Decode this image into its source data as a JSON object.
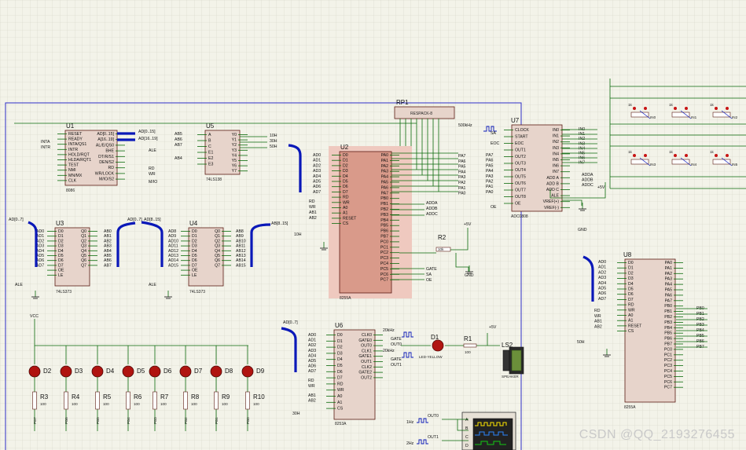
{
  "chips": {
    "u1": {
      "ref": "U1",
      "type": "8086",
      "left_pins": [
        "RESET",
        "READY",
        "INTA/QS1",
        "INTR",
        "HOLD/RQT",
        "HLDA/RQT1",
        "TEST",
        "NMI",
        "MN/MX",
        "CLK"
      ],
      "right_pins": [
        "AD[0..15]",
        "A[16..19]",
        "AL/E/QS0",
        "BHE",
        "DT/R/S1",
        "DEN/S2",
        "RD",
        "WR/LOCK",
        "M/IO/S2"
      ],
      "in_labels": [
        "INTA",
        "INTR"
      ],
      "out_labels": [
        "AD[0..15]",
        "AD[16..19]",
        "ALE",
        "RD",
        "WR",
        "M/IO"
      ]
    },
    "u5": {
      "ref": "U5",
      "type": "74LS138",
      "left_pins": [
        "A",
        "B",
        "C",
        "E1",
        "E2",
        "E3"
      ],
      "right_pins": [
        "Y0",
        "Y1",
        "Y2",
        "Y3",
        "Y4",
        "Y5",
        "Y6",
        "Y7"
      ],
      "in_labels": [
        "AB5",
        "AB6",
        "AB7",
        "AB4"
      ],
      "out_labels": [
        "10H",
        "30H",
        "50H"
      ]
    },
    "u2": {
      "ref": "U2",
      "type": "8255A",
      "left_pins": [
        "D0",
        "D1",
        "D2",
        "D3",
        "D4",
        "D5",
        "D6",
        "D7",
        "RD",
        "WR",
        "A0",
        "A1",
        "RESET",
        "CS"
      ],
      "right_pins": [
        "PA0",
        "PA1",
        "PA2",
        "PA3",
        "PA4",
        "PA5",
        "PA6",
        "PA7",
        "PB0",
        "PB1",
        "PB2",
        "PB3",
        "PB4",
        "PB5",
        "PB6",
        "PB7",
        "PC0",
        "PC1",
        "PC2",
        "PC3",
        "PC4",
        "PC5",
        "PC6",
        "PC7"
      ],
      "in_labels": [
        "AD0",
        "AD1",
        "AD2",
        "AD3",
        "AD4",
        "AD5",
        "AD6",
        "AD7",
        "RD",
        "WR",
        "AB1",
        "AB2",
        "10H"
      ],
      "out_labels": [
        "PA7",
        "PA6",
        "PA5",
        "PA4",
        "PA3",
        "PA2",
        "PA1",
        "PA0",
        "ADDA",
        "ADDB",
        "ADDC",
        "GATE",
        "SA",
        "OE"
      ]
    },
    "u7": {
      "ref": "U7",
      "type": "ADC0808",
      "left_pins": [
        "CLOCK",
        "START",
        "EOC",
        "OUT1",
        "OUT2",
        "OUT3",
        "OUT4",
        "OUT5",
        "OUT6",
        "OUT7",
        "OUT8",
        "OE"
      ],
      "right_pins": [
        "IN0",
        "IN1",
        "IN2",
        "IN3",
        "IN4",
        "IN5",
        "IN6",
        "IN7",
        "ADD A",
        "ADD B",
        "ADD C",
        "ALE",
        "VREF(+)",
        "VREF(-)"
      ],
      "in_labels": [
        "SA",
        "EOC",
        "PA7",
        "PA6",
        "PA5",
        "PA4",
        "PA3",
        "PA2",
        "PA1",
        "PA0",
        "OE"
      ],
      "out_labels": [
        "IN0",
        "IN1",
        "IN2",
        "IN3",
        "IN4",
        "IN5",
        "IN6",
        "IN7",
        "ADDA",
        "ADDB",
        "ADDC",
        "+5V",
        "GND"
      ]
    },
    "u3": {
      "ref": "U3",
      "type": "74LS373",
      "left_pins": [
        "D0",
        "D1",
        "D2",
        "D3",
        "D4",
        "D5",
        "D6",
        "D7",
        "OE",
        "LE"
      ],
      "right_pins": [
        "Q0",
        "Q1",
        "Q2",
        "Q3",
        "Q4",
        "Q5",
        "Q6",
        "Q7"
      ],
      "in_labels": [
        "AD0",
        "AD1",
        "AD2",
        "AD3",
        "AD4",
        "AD5",
        "AD6",
        "AD7",
        "ALE"
      ],
      "out_labels": [
        "AB0",
        "AB1",
        "AB2",
        "AB3",
        "AB4",
        "AB5",
        "AB6",
        "AB7"
      ]
    },
    "u4": {
      "ref": "U4",
      "type": "74LS373",
      "left_pins": [
        "D0",
        "D1",
        "D2",
        "D3",
        "D4",
        "D5",
        "D6",
        "D7",
        "OE",
        "LE"
      ],
      "right_pins": [
        "Q0",
        "Q1",
        "Q2",
        "Q3",
        "Q4",
        "Q5",
        "Q6",
        "Q7"
      ],
      "in_labels": [
        "AD8",
        "AD9",
        "AD10",
        "AD11",
        "AD12",
        "AD13",
        "AD14",
        "AD15",
        "ALE"
      ],
      "out_labels": [
        "AB8",
        "AB9",
        "AB10",
        "AB11",
        "AB12",
        "AB13",
        "AB14",
        "AB15"
      ]
    },
    "u6": {
      "ref": "U6",
      "type": "8253A",
      "left_pins": [
        "D0",
        "D1",
        "D2",
        "D3",
        "D4",
        "D5",
        "D6",
        "D7",
        "RD",
        "WR",
        "A0",
        "A1",
        "CS"
      ],
      "right_pins": [
        "CLK0",
        "GATE0",
        "OUT0",
        "CLK1",
        "GATE1",
        "OUT1",
        "CLK2",
        "GATE2",
        "OUT2"
      ],
      "in_labels": [
        "AD0",
        "AD1",
        "AD2",
        "AD3",
        "AD4",
        "AD5",
        "AD6",
        "AD7",
        "RD",
        "WR",
        "AB1",
        "AB2",
        "30H"
      ],
      "out_labels": [
        "20kHz",
        "GATE",
        "OUT0",
        "20kHz",
        "GATE",
        "OUT1"
      ]
    },
    "u8": {
      "ref": "U8",
      "type": "8255A",
      "left_pins": [
        "D0",
        "D1",
        "D2",
        "D3",
        "D4",
        "D5",
        "D6",
        "D7",
        "RD",
        "WR",
        "A0",
        "A1",
        "RESET",
        "CS"
      ],
      "right_pins": [
        "PA0",
        "PA1",
        "PA2",
        "PA3",
        "PA4",
        "PA5",
        "PA6",
        "PA7",
        "PB0",
        "PB1",
        "PB2",
        "PB3",
        "PB4",
        "PB5",
        "PB6",
        "PB7",
        "PC0",
        "PC1",
        "PC2",
        "PC3",
        "PC4",
        "PC5",
        "PC6",
        "PC7"
      ],
      "in_labels": [
        "AD0",
        "AD1",
        "AD2",
        "AD3",
        "AD4",
        "AD5",
        "AD6",
        "AD7",
        "RD",
        "WR",
        "AB1",
        "AB2",
        "50H"
      ],
      "out_labels": [
        "PB0",
        "PB1",
        "PB2",
        "PB3",
        "PB4",
        "PB5",
        "PB6",
        "PB7"
      ]
    }
  },
  "buses": {
    "ad07": "AD[0..7]",
    "ad815": "AD[8..15]",
    "ab815": "AB[8..15]"
  },
  "rp1": {
    "ref": "RP1",
    "type": "RESPACK-8"
  },
  "r2": {
    "ref": "R2",
    "value": "10k"
  },
  "clock": {
    "label": "500kHz"
  },
  "power": {
    "vcc": "VCC",
    "plus5": "+5V",
    "gnd": "GND"
  },
  "leds": [
    {
      "ref": "D2"
    },
    {
      "ref": "D3"
    },
    {
      "ref": "D4"
    },
    {
      "ref": "D5"
    },
    {
      "ref": "D6"
    },
    {
      "ref": "D7"
    },
    {
      "ref": "D8"
    },
    {
      "ref": "D9"
    }
  ],
  "resistors": [
    {
      "ref": "R3",
      "value": "100",
      "net": "PB7"
    },
    {
      "ref": "R4",
      "value": "100",
      "net": "PB6"
    },
    {
      "ref": "R5",
      "value": "100",
      "net": "PB5"
    },
    {
      "ref": "R6",
      "value": "100",
      "net": "PB4"
    },
    {
      "ref": "R7",
      "value": "100",
      "net": "PB3"
    },
    {
      "ref": "R8",
      "value": "100",
      "net": "PB2"
    },
    {
      "ref": "R9",
      "value": "100",
      "net": "PB1"
    },
    {
      "ref": "R10",
      "value": "100",
      "net": "PB0"
    }
  ],
  "d1": {
    "ref": "D1",
    "type": "LED-YELLOW"
  },
  "r1": {
    "ref": "R1",
    "value": "100"
  },
  "ls2": {
    "ref": "LS2",
    "type": "SPEAKER"
  },
  "scope": {
    "channels": [
      "A",
      "B",
      "C",
      "D"
    ],
    "sources": [
      {
        "freq": "1Hz",
        "net": "OUT0"
      },
      {
        "freq": "2Hz",
        "net": "OUT1"
      }
    ]
  },
  "pots": [
    "IN0",
    "IN1",
    "IN2",
    "IN3",
    "IN4",
    "IN5"
  ],
  "pot_value": "1k",
  "watermark": "CSDN @QQ_2193276455"
}
